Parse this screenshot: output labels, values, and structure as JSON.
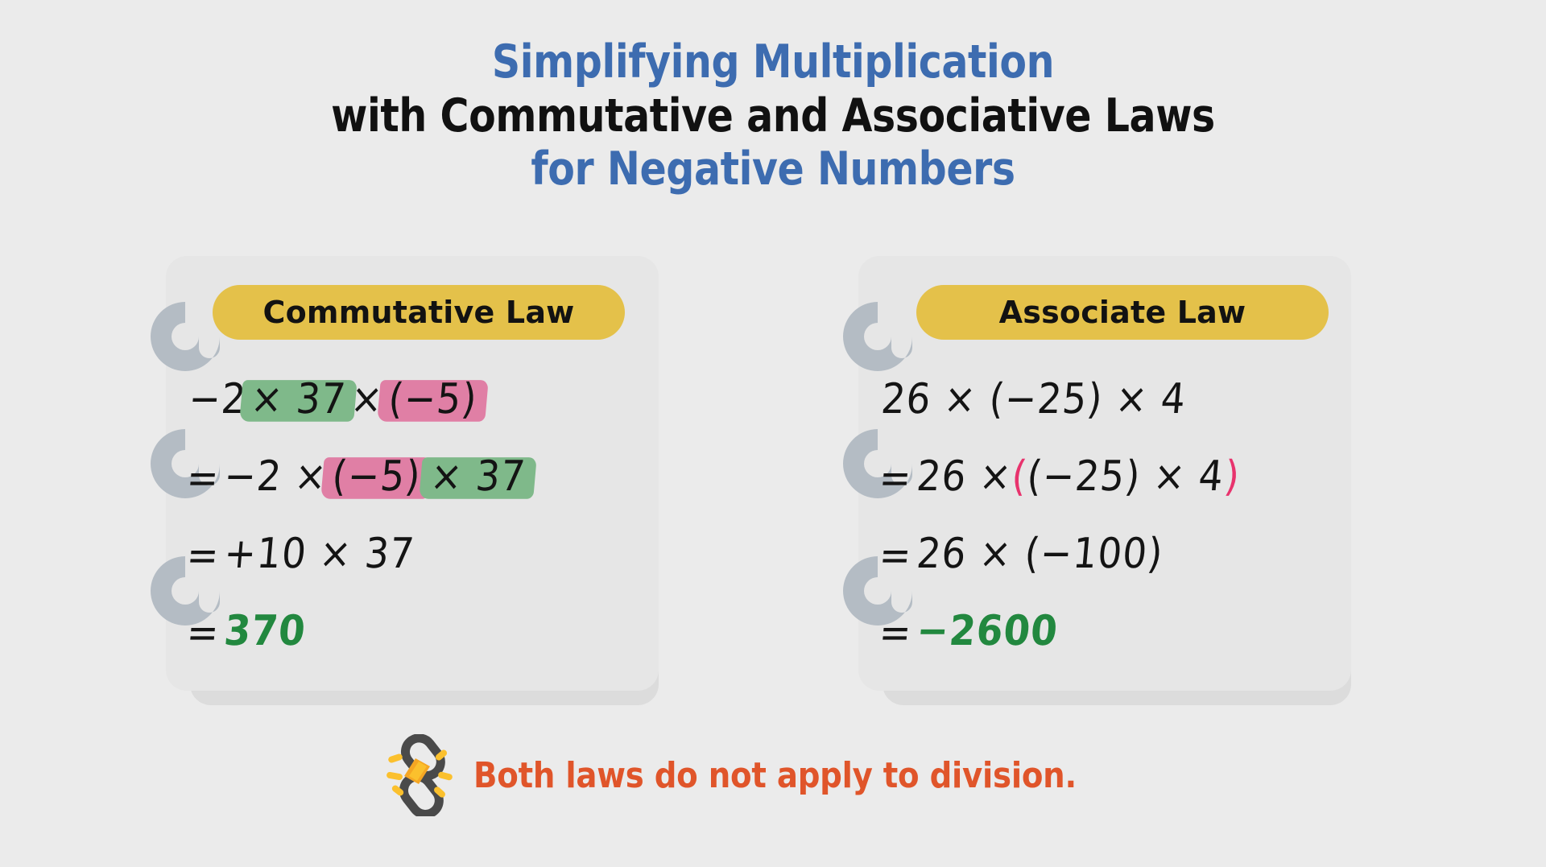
{
  "title": {
    "line1": "Simplifying Multiplication",
    "line2": "with Commutative and Associative Laws",
    "line3": "for Negative Numbers"
  },
  "colors": {
    "background": "#ebebeb",
    "title_blue": "#3d6cb0",
    "title_black": "#111111",
    "badge_yellow": "#e4c14a",
    "card_front": "#e6e6e6",
    "card_back": "#dcdcdc",
    "ring_gray": "#b4bcc4",
    "highlight_green": "#7fb98a",
    "highlight_pink": "#e07fa5",
    "ink_pink": "#e8336d",
    "ink_green": "#22883f",
    "footer_orange": "#e0552a"
  },
  "cards": [
    {
      "id": "commutative",
      "badge_label": "Commutative Law",
      "ring_count": 3,
      "lines": [
        {
          "prefix": "",
          "parts": [
            {
              "text": "−2 ",
              "style": "plain"
            },
            {
              "text": "× 37",
              "style": "highlight-green"
            },
            {
              "text": " × ",
              "style": "plain"
            },
            {
              "text": "(−5)",
              "style": "highlight-pink"
            }
          ]
        },
        {
          "prefix": "=",
          "parts": [
            {
              "text": " −2 × ",
              "style": "plain"
            },
            {
              "text": "(−5)",
              "style": "highlight-pink"
            },
            {
              "text": " ",
              "style": "plain"
            },
            {
              "text": "× 37",
              "style": "highlight-green"
            }
          ]
        },
        {
          "prefix": "=",
          "parts": [
            {
              "text": " +10 × 37",
              "style": "plain"
            }
          ]
        },
        {
          "prefix": "=",
          "parts": [
            {
              "text": "  370",
              "style": "answer-green"
            }
          ]
        }
      ]
    },
    {
      "id": "associative",
      "badge_label": "Associate Law",
      "ring_count": 3,
      "lines": [
        {
          "prefix": "",
          "parts": [
            {
              "text": "26 × (−25) × 4",
              "style": "plain"
            }
          ]
        },
        {
          "prefix": "=",
          "parts": [
            {
              "text": " 26 × ",
              "style": "plain"
            },
            {
              "text": "(",
              "style": "ink-pink"
            },
            {
              "text": "(−25) × 4",
              "style": "plain"
            },
            {
              "text": ")",
              "style": "ink-pink"
            }
          ]
        },
        {
          "prefix": "=",
          "parts": [
            {
              "text": " 26 × (−100)",
              "style": "plain"
            }
          ]
        },
        {
          "prefix": "=",
          "parts": [
            {
              "text": "  −2600",
              "style": "answer-green"
            }
          ]
        }
      ]
    }
  ],
  "footer": {
    "icon": "broken-chain-icon",
    "note": "Both laws do not apply to division."
  }
}
